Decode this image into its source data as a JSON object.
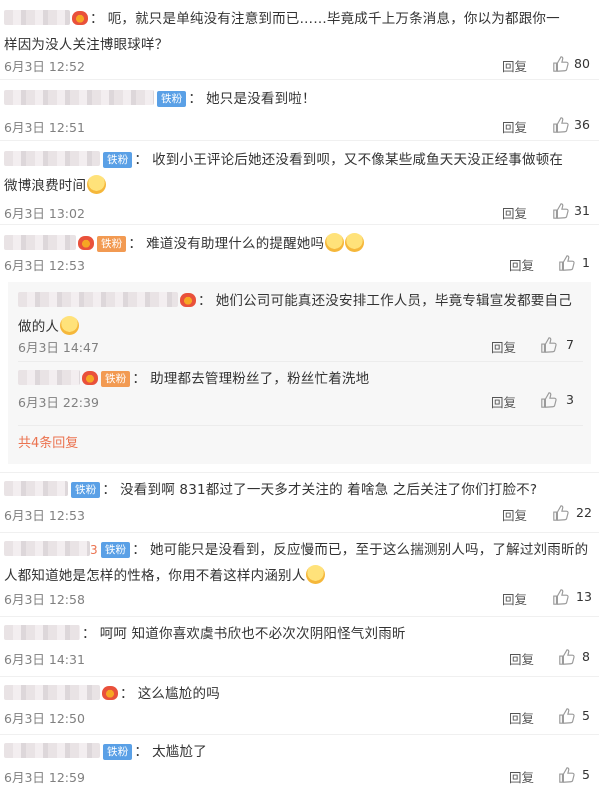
{
  "comments": [
    {
      "badge": "vip",
      "text": "呃，就只是单纯没有注意到而已……毕竟成千上万条消息，你以为都跟你一样因为没人关注博眼球咩？",
      "time": "6月3日 12:52",
      "reply": "回复",
      "likes": "80"
    },
    {
      "badge": "fan",
      "fan_label": "铁粉",
      "text": "她只是没看到啦！",
      "time": "6月3日 12:51",
      "reply": "回复",
      "likes": "36"
    },
    {
      "badge": "fan",
      "fan_label": "铁粉",
      "text": "收到小王评论后她还没看到呗，又不像某些咸鱼天天没正经事做顿在微博浪费时间",
      "time": "6月3日 13:02",
      "reply": "回复",
      "likes": "31"
    },
    {
      "badge": "vip-fan",
      "fan_label": "铁粉",
      "text": "难道没有助理什么的提醒她吗",
      "time": "6月3日 12:53",
      "reply": "回复",
      "likes": "1"
    },
    {
      "badge": "fan",
      "fan_label": "铁粉",
      "text": "没看到啊 831都过了一天多才关注的 着啥急 之后关注了你们打脸不?",
      "time": "6月3日 12:53",
      "reply": "回复",
      "likes": "22"
    },
    {
      "badge": "fan",
      "fan_label": "铁粉",
      "prefix": "3",
      "text": "她可能只是没看到，反应慢而已，至于这么揣测别人吗，了解过刘雨昕的人都知道她是怎样的性格，你用不着这样内涵别人",
      "time": "6月3日 12:58",
      "reply": "回复",
      "likes": "13"
    },
    {
      "badge": "none",
      "text": "呵呵  知道你喜欢虞书欣也不必次次阴阳怪气刘雨昕",
      "time": "6月3日 14:31",
      "reply": "回复",
      "likes": "8"
    },
    {
      "badge": "vip",
      "text": "这么尴尬的吗",
      "time": "6月3日 12:50",
      "reply": "回复",
      "likes": "5"
    },
    {
      "badge": "fan",
      "fan_label": "铁粉",
      "text": "太尴尬了",
      "time": "6月3日 12:59",
      "reply": "回复",
      "likes": "5"
    }
  ],
  "sub_replies": [
    {
      "badge": "vip",
      "text": "她们公司可能真还没安排工作人员，毕竟专辑宣发都要自己做的人",
      "time": "6月3日 14:47",
      "reply": "回复",
      "likes": "7"
    },
    {
      "badge": "vip-fan",
      "fan_label": "铁粉",
      "text": "助理都去管理粉丝了，粉丝忙着洗地",
      "time": "6月3日 22:39",
      "reply": "回复",
      "likes": "3"
    }
  ],
  "more_replies": "共4条回复",
  "icons": {
    "like": "thumbs-up-icon",
    "vip": "vip-crown-icon",
    "emoji": "smiley-emoji-icon"
  }
}
